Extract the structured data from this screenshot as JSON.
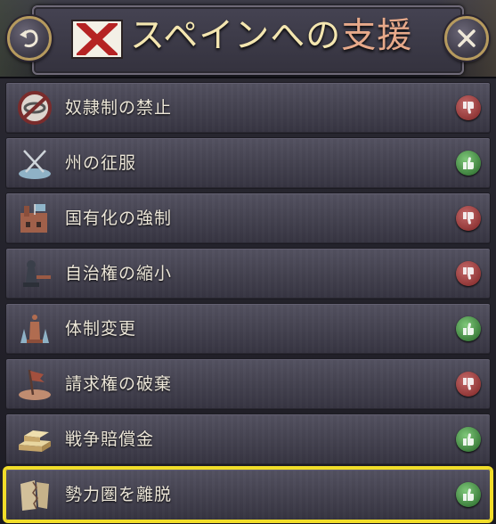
{
  "header": {
    "title_main": "スペインへの",
    "title_accent": "支援",
    "back_icon": "back-arrow-icon",
    "close_icon": "close-icon"
  },
  "colors": {
    "highlight": "#f1dd2a",
    "thumb_down": "#a84444",
    "thumb_up": "#4f9a4b",
    "title_text": "#f4e6b0",
    "title_accent": "#e7a98a"
  },
  "items": [
    {
      "label": "奴隷制の禁止",
      "icon": "no-slavery-icon",
      "verdict": "down"
    },
    {
      "label": "州の征服",
      "icon": "crossed-swords-icon",
      "verdict": "up"
    },
    {
      "label": "国有化の強制",
      "icon": "factory-icon",
      "verdict": "down"
    },
    {
      "label": "自治権の縮小",
      "icon": "chess-pawn-icon",
      "verdict": "down"
    },
    {
      "label": "体制変更",
      "icon": "chess-pieces-icon",
      "verdict": "up"
    },
    {
      "label": "請求権の破棄",
      "icon": "torn-flag-icon",
      "verdict": "down"
    },
    {
      "label": "戦争賠償金",
      "icon": "gold-bars-icon",
      "verdict": "up"
    },
    {
      "label": "勢力圏を離脱",
      "icon": "torn-document-icon",
      "verdict": "up",
      "selected": true
    }
  ]
}
